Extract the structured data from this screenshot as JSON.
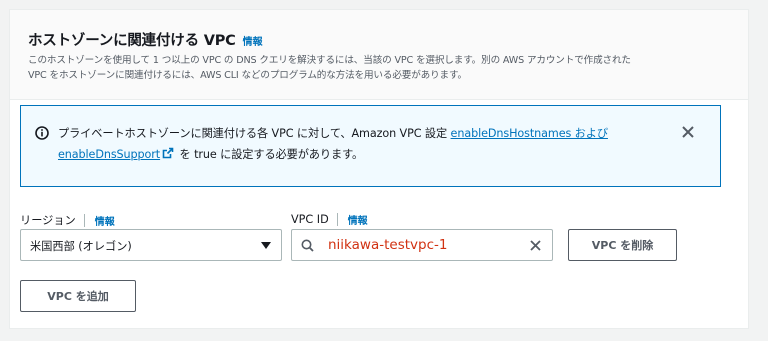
{
  "header": {
    "title": "ホストゾーンに関連付ける VPC",
    "info_link": "情報",
    "description_line1": "このホストゾーンを使用して 1 つ以上の VPC の DNS クエリを解決するには、当該の VPC を選択します。別の AWS アカウントで作成された",
    "description_line2": "VPC をホストゾーンに関連付けるには、AWS CLI などのプログラム的な方法を用いる必要があります。"
  },
  "alert": {
    "icon": "info-icon",
    "text_before": "プライベートホストゾーンに関連付ける各 VPC に対して、Amazon VPC 設定 ",
    "link_text": "enableDnsHostnames および enableDnsSupport",
    "text_after": " を true に設定する必要があります。",
    "link_color": "#0073bb"
  },
  "region": {
    "label": "リージョン",
    "info_link": "情報",
    "selected_value": "米国西部 (オレゴン)"
  },
  "vpc": {
    "label": "VPC ID",
    "info_link": "情報",
    "value": "niikawa-testvpc-1"
  },
  "buttons": {
    "remove_vpc": "VPC を削除",
    "add_vpc": "VPC を追加"
  },
  "colors": {
    "accent": "#0073bb",
    "alert_bg": "#f1faff",
    "value_highlight": "#d13212"
  }
}
